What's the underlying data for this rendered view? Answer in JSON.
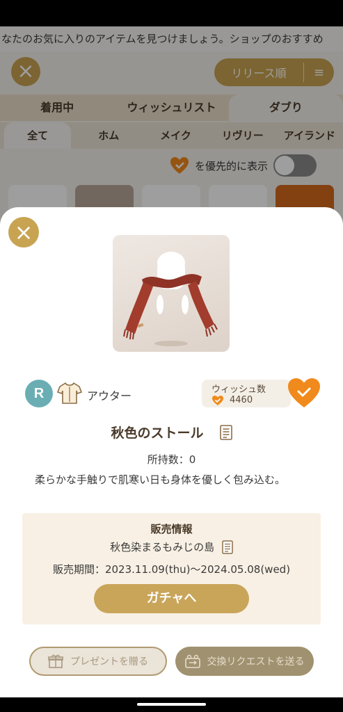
{
  "background": {
    "ticker": "なたのお気に入りのアイテムを見つけましょう。ショップのおすすめ",
    "sort_label": "リリース順",
    "main_tabs": [
      {
        "label": "着用中"
      },
      {
        "label": "ウィッシュリスト"
      },
      {
        "label": "ダブり"
      }
    ],
    "sub_tabs": [
      {
        "label": "全て"
      },
      {
        "label": "ホム"
      },
      {
        "label": "メイク"
      },
      {
        "label": "リヴリー"
      },
      {
        "label": "アイランド"
      }
    ],
    "priority_label": "を優先的に表示",
    "priority_toggle": "off"
  },
  "item": {
    "rarity": "R",
    "category": "アウター",
    "wish_label": "ウィッシュ数",
    "wish_count": "4460",
    "name": "秋色のストール",
    "owned": "所持数：0",
    "description": "柔らかな手触りで肌寒い日も身体を優しく包み込む。"
  },
  "sale": {
    "title": "販売情報",
    "island": "秋色染まるもみじの島",
    "period": "販売期間：2023.11.09(thu)〜2024.05.08(wed)",
    "gacha_button": "ガチャへ"
  },
  "footer": {
    "present_button": "プレゼントを贈る",
    "trade_button": "交換リクエストを送る"
  },
  "colors": {
    "accent_gold": "#c8a452",
    "wish_orange": "#f08a1c",
    "rarity_teal": "#6aaeb4",
    "sale_bg": "#f8f0e4"
  }
}
